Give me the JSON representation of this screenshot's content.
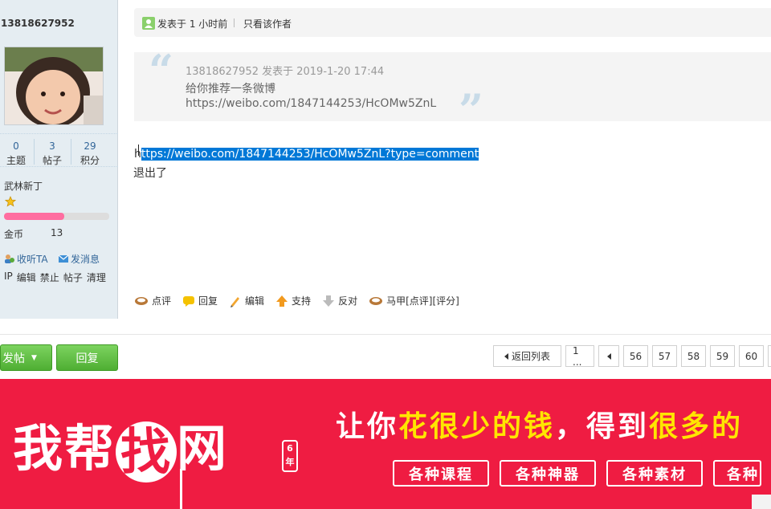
{
  "user": {
    "name": "13818627952",
    "stats": [
      {
        "value": "0",
        "label": "主题"
      },
      {
        "value": "3",
        "label": "帖子"
      },
      {
        "value": "29",
        "label": "积分"
      }
    ],
    "group": "武林新丁",
    "level_progress": 0.57,
    "coin_label": "金币",
    "coin_value": "13",
    "follow_label": "收听TA",
    "message_label": "发消息",
    "admin_links": [
      "IP",
      "编辑",
      "禁止",
      "帖子",
      "清理"
    ]
  },
  "post": {
    "posted_time": "发表于 1 小时前",
    "only_author": "只看该作者",
    "quote": {
      "meta": "13818627952 发表于 2019-1-20 17:44",
      "line1": "给你推荐一条微博",
      "line2": "https://weibo.com/1847144253/HcOMw5ZnL"
    },
    "body_prefix": "h",
    "body_selected": "ttps://weibo.com/1847144253/HcOMw5ZnL?type=comment",
    "body_line2": "退出了",
    "actions": [
      "点评",
      "回复",
      "编辑",
      "支持",
      "反对",
      "马甲[点评][评分]"
    ]
  },
  "toolbar": {
    "new_post": "发帖",
    "reply": "回复",
    "back_to_list": "返回列表",
    "first_page": "1 ...",
    "pages": [
      "56",
      "57",
      "58",
      "59",
      "60"
    ]
  },
  "banner": {
    "logo_a": "我帮",
    "logo_circle": "找",
    "logo_b": "网",
    "badge_6": "6",
    "badge_year": "年",
    "slogan_a": "让你",
    "slogan_hl1": "花很少的钱",
    "slogan_b": "，得到",
    "slogan_hl2": "很多的",
    "tags": [
      "各种课程",
      "各种神器",
      "各种素材",
      "各种"
    ]
  },
  "colors": {
    "link": "#336699",
    "green_button": "#4fae33",
    "banner_red": "#ef1c42",
    "banner_highlight": "#ffe500",
    "selection": "#0078d7"
  }
}
